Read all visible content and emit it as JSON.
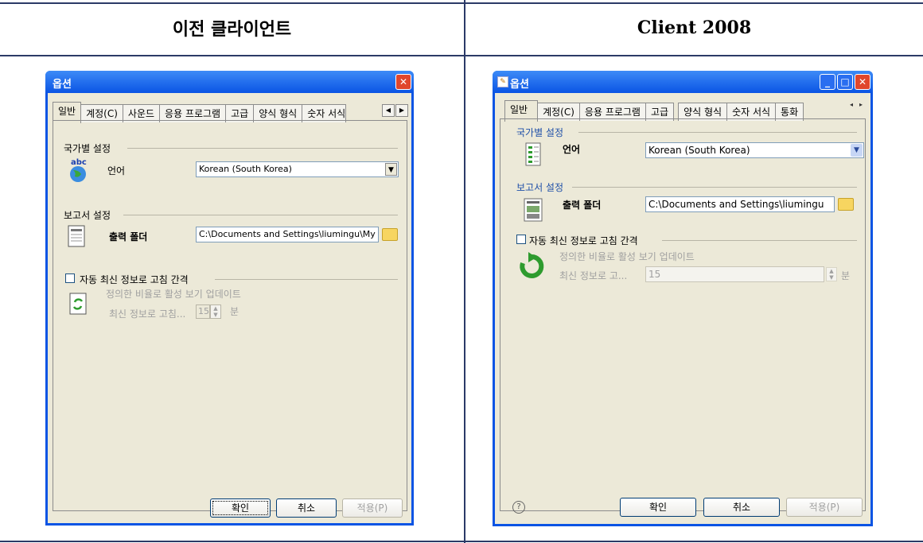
{
  "headers": {
    "left": "이전 클라이언트",
    "right": "Client 2008"
  },
  "old_dialog": {
    "title": "옵션",
    "tabs": [
      "일반",
      "계정(C)",
      "사운드",
      "응용 프로그램",
      "고급",
      "양식 형식",
      "숫자 서식"
    ],
    "regional_section": "국가별 설정",
    "language_label": "언어",
    "language_value": "Korean (South Korea)",
    "report_section": "보고서 설정",
    "output_folder_label": "출력 폴더",
    "output_folder_value": "C:\\Documents and Settings\\liumingu\\My",
    "auto_refresh_label": "자동 최신 정보로 고침 간격",
    "auto_refresh_desc": "정의한 비율로 활성 보기 업데이트",
    "refresh_label": "최신 정보로 고침...",
    "refresh_value": "15",
    "refresh_unit": "분",
    "ok": "확인",
    "cancel": "취소",
    "apply": "적용(P)"
  },
  "new_dialog": {
    "title": "옵션",
    "tabs": [
      "일반",
      "계정(C)",
      "응용 프로그램",
      "고급",
      "양식 형식",
      "숫자 서식",
      "통화"
    ],
    "regional_section": "국가별 설정",
    "language_label": "언어",
    "language_value": "Korean (South Korea)",
    "report_section": "보고서 설정",
    "output_folder_label": "출력 폴더",
    "output_folder_value": "C:\\Documents and Settings\\liumingu",
    "auto_refresh_label": "자동 최신 정보로 고침 간격",
    "auto_refresh_desc": "정의한 비율로 활성 보기 업데이트",
    "refresh_label": "최신 정보로 고...",
    "refresh_value": "15",
    "refresh_unit": "분",
    "help_icon": "?",
    "ok": "확인",
    "cancel": "취소",
    "apply": "적용(P)"
  },
  "colors": {
    "rule": "#2b3a67",
    "xp_title": "#0a54e4",
    "green_refresh": "#2e9b2e"
  }
}
